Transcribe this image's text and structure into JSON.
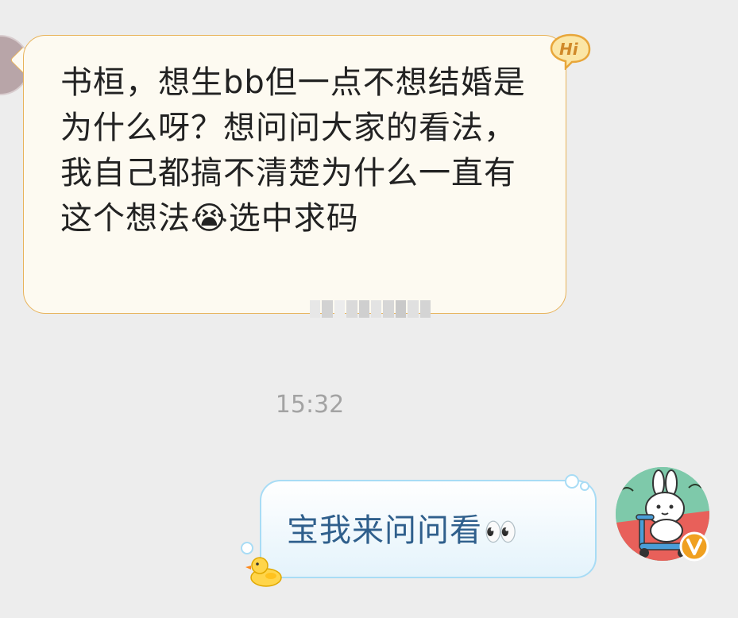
{
  "conversation": {
    "incoming": {
      "text": "书桓，想生bb但一点不想结婚是为什么呀？想问问大家的看法，我自己都搞不清楚为什么一直有这个想法😭选中求码",
      "badge_label": "Hi"
    },
    "timestamp": "15:32",
    "outgoing": {
      "text": "宝我来问问看",
      "emoji": "👀"
    }
  },
  "colors": {
    "incoming_bubble_bg": "#fdfaf1",
    "incoming_bubble_border": "#e8b35a",
    "outgoing_bubble_border": "#a8dcf5",
    "outgoing_text": "#2f5f8c",
    "vip_badge": "#f0a020"
  },
  "icons": {
    "hi_badge": "hi-speech-bubble-icon",
    "duck": "rubber-duck-icon",
    "vip": "vip-v-badge-icon"
  }
}
